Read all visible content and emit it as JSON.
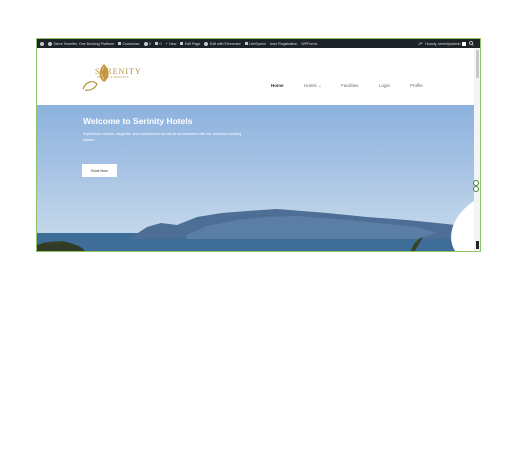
{
  "admin_bar": {
    "site_name": "Steve Hoseifer, One Booking Platform",
    "customize": "Customize",
    "updates_count": "0",
    "comments_count": "0",
    "new": "New",
    "edit_page": "Edit Page",
    "edit_elementor": "Edit with Elementor",
    "litespeed": "LiteSpeed",
    "user_registration": "User Registration",
    "wpforms": "WPForms",
    "howdy": "Howdy, serenityadmin"
  },
  "brand": {
    "name": "SERENITY",
    "tagline": "HOTELS & RESORTS",
    "color": "#b8923a"
  },
  "nav": {
    "items": [
      "Home",
      "Hotels",
      "Facilities",
      "Login",
      "Profile"
    ],
    "active": "Home"
  },
  "hero": {
    "title": "Welcome to Serinity Hotels",
    "text": "Experience comfort, elegance, and convenience across all our branches with our seamless booking system.",
    "button": "Book Now"
  },
  "icons": [
    "wordpress-icon",
    "home-icon",
    "brush-icon",
    "refresh-icon",
    "comment-icon",
    "plus-icon",
    "pencil-icon",
    "elementor-icon",
    "litespeed-icon",
    "search-icon"
  ]
}
